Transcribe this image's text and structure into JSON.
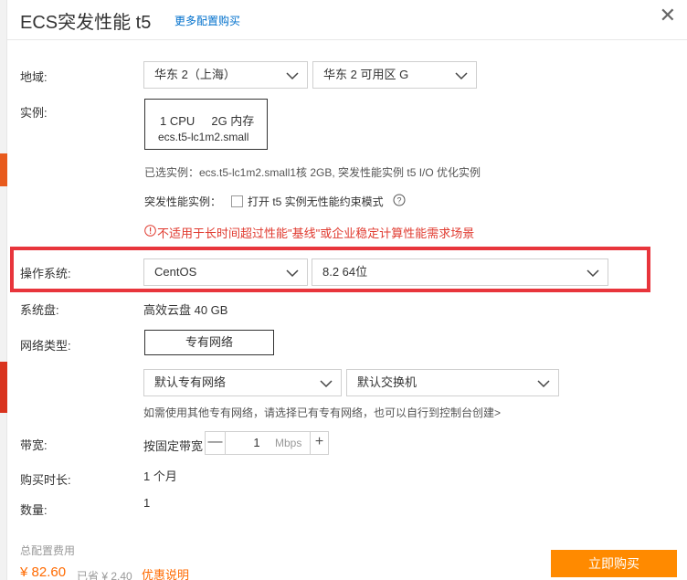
{
  "header": {
    "title": "ECS突发性能 t5",
    "more_link": "更多配置购买",
    "close": "✕"
  },
  "region": {
    "label": "地域:",
    "region_value": "华东 2（上海）",
    "zone_value": "华东 2 可用区 G"
  },
  "instance": {
    "label": "实例:",
    "card_line1": "1 CPU     2G 内存",
    "card_line2": "ecs.t5-lc1m2.small",
    "selected_text": "已选实例：ecs.t5-lc1m2.small1核 2GB, 突发性能实例 t5 I/O 优化实例",
    "burst_label": "突发性能实例：",
    "burst_checkbox_label": "打开 t5 实例无性能约束模式",
    "warning": "不适用于长时间超过性能\"基线\"或企业稳定计算性能需求场景"
  },
  "os": {
    "label": "操作系统:",
    "os_value": "CentOS",
    "version_value": "8.2 64位"
  },
  "disk": {
    "label": "系统盘:",
    "value": "高效云盘 40 GB"
  },
  "network": {
    "label": "网络类型:",
    "type_button": "专有网络",
    "vpc_value": "默认专有网络",
    "vswitch_value": "默认交换机",
    "hint": "如需使用其他专有网络，请选择已有专有网络，也可以自行到控制台创建>"
  },
  "bandwidth": {
    "label": "带宽:",
    "mode": "按固定带宽",
    "minus": "—",
    "value": "1",
    "unit": "Mbps",
    "plus": "+"
  },
  "duration": {
    "label": "购买时长:",
    "value": "1 个月"
  },
  "quantity": {
    "label": "数量:",
    "value": "1"
  },
  "footer": {
    "total_label": "总配置费用",
    "price": "¥ 82.60",
    "saved": "已省 ¥ 2.40",
    "discount_link": "优惠说明",
    "buy_button": "立即购买"
  },
  "colors": {
    "accent": "#ff8a00",
    "link": "#0070cc",
    "warning": "#e03a2f",
    "highlight_border": "#e8353c"
  }
}
